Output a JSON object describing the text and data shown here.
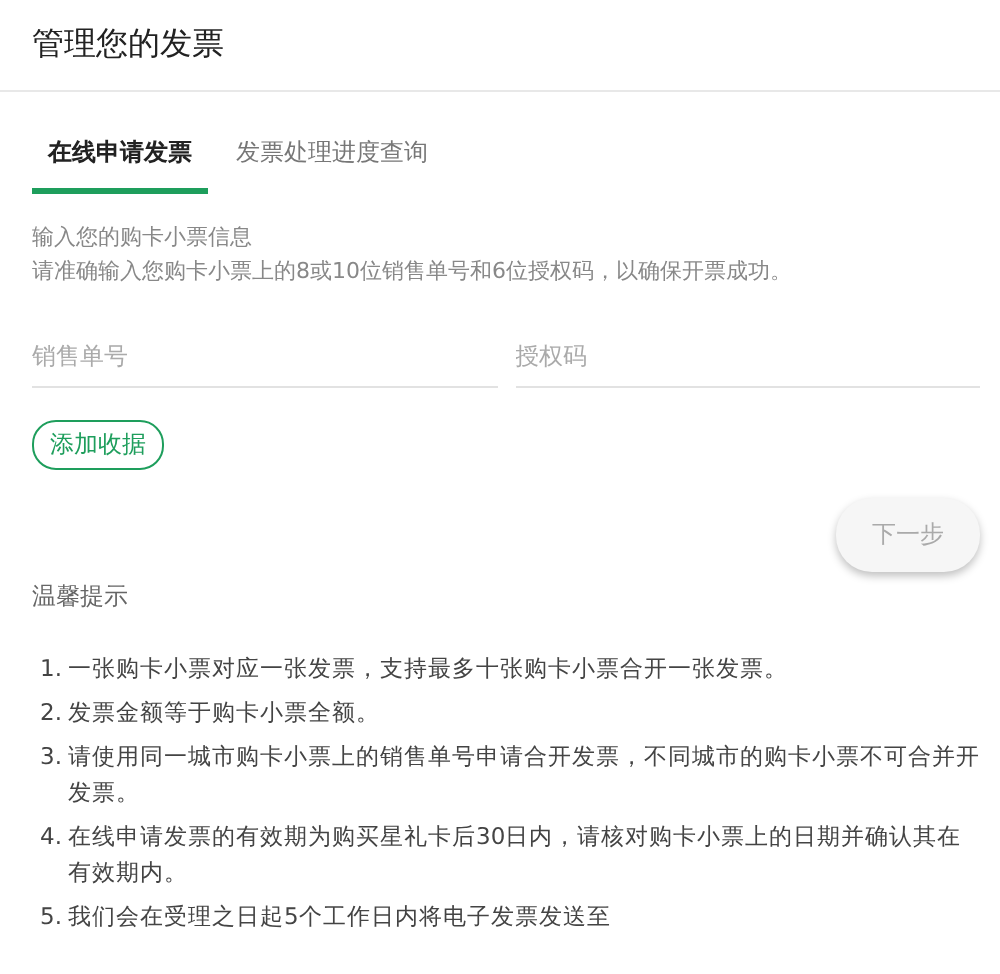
{
  "title": "管理您的发票",
  "tabs": [
    {
      "label": "在线申请发票",
      "selected": true
    },
    {
      "label": "发票处理进度查询",
      "selected": false
    }
  ],
  "intro": {
    "heading": "输入您的购卡小票信息",
    "text": "请准确输入您购卡小票上的8或10位销售单号和6位授权码，以确保开票成功。"
  },
  "fields": [
    {
      "placeholder": "销售单号"
    },
    {
      "placeholder": "授权码"
    }
  ],
  "add_button": "添加收据",
  "next_button": {
    "label": "下一步",
    "disabled": true
  },
  "tips": {
    "heading": "温馨提示",
    "items": [
      {
        "number": "1.",
        "text": "一张购卡小票对应一张发票，支持最多十张购卡小票合开一张发票。"
      },
      {
        "number": "2.",
        "text": "发票金额等于购卡小票全额。"
      },
      {
        "number": "3.",
        "text": "请使用同一城市购卡小票上的销售单号申请合开发票，不同城市的购卡小票不可合并开发票。"
      },
      {
        "number": "4.",
        "text": "在线申请发票的有效期为购买星礼卡后30日内，请核对购卡小票上的日期并确认其在有效期内。"
      },
      {
        "number": "5.",
        "text": "我们会在受理之日起5个工作日内将电子发票发送至"
      }
    ]
  }
}
